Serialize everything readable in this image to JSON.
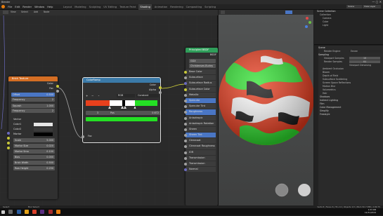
{
  "app": {
    "title": "Blender"
  },
  "menus": [
    "File",
    "Edit",
    "Render",
    "Window",
    "Help"
  ],
  "workspaces": [
    "Layout",
    "Modeling",
    "Sculpting",
    "UV Editing",
    "Texture Paint",
    "Shading",
    "Animation",
    "Rendering",
    "Compositing",
    "Scripting"
  ],
  "active_workspace": "Shading",
  "brick_node": {
    "title": "Brick Texture",
    "outputs": [
      "Color",
      "Fac"
    ],
    "offset_label": "Offset",
    "offset_value": "0.500",
    "frequency_label": "Frequency",
    "frequency_value": "2",
    "squash_label": "Squash",
    "squash_value": "1.000",
    "squash_freq_label": "Frequency",
    "squash_freq_value": "2",
    "inputs": [
      "Vector",
      "Color1",
      "Color2",
      "Mortar"
    ],
    "scale_label": "Scale",
    "scale_value": "5.000",
    "mortar_size_label": "Mortar Size",
    "mortar_size_value": "0.020",
    "mortar_smooth_label": "Mortar Smo",
    "mortar_smooth_value": "0.100",
    "bias_label": "Bias",
    "bias_value": "0.000",
    "brick_width_label": "Brick Width",
    "brick_width_value": "0.500",
    "row_height_label": "Row Height",
    "row_height_value": "0.250"
  },
  "colorramp_node": {
    "title": "ColorRamp",
    "outputs": [
      "Color",
      "Alpha"
    ],
    "mode": "RGB",
    "interpolation": "Constant",
    "stop_index": "3",
    "pos_label": "Pos",
    "pos_value": "0.672",
    "input": "Fac",
    "colors": {
      "red": "#e8401c",
      "white": "#ffffff",
      "black": "#000000",
      "green": "#24e024"
    }
  },
  "bsdf_node": {
    "title": "Principled BSDF",
    "output": "BSDF",
    "distribution": "GGX",
    "subsurface_method": "Christensen-Burley",
    "inputs": [
      "Base Color",
      "Subsurface",
      "Subsurface Radius",
      "Subsurface Color",
      "Metallic",
      "Specular",
      "Specular Tint",
      "Roughness",
      "Anisotropic",
      "Anisotropic Rotation",
      "Sheen",
      "Sheen Tint",
      "Clearcoat",
      "Clearcoat Roughness",
      "IOR",
      "Transmission",
      "Transmission Roughness",
      "Normal"
    ]
  },
  "outliner": {
    "title": "Scene Collection",
    "items": [
      "Collection",
      "Camera",
      "Cube",
      "Light"
    ]
  },
  "properties": {
    "section": "Scene",
    "render_engine_label": "Render Engine",
    "render_engine": "Eevee",
    "sampling": "Sampling",
    "viewport_samples_label": "Viewport Samples",
    "viewport_samples": "16",
    "render_samples_label": "Render Samples",
    "render_samples": "64",
    "denoise": "Viewport Denoising",
    "panels": [
      "Ambient Occlusion",
      "Bloom",
      "Depth of Field",
      "Subsurface Scattering",
      "Screen Space Reflections",
      "Motion Blur",
      "Volumetrics",
      "Hair",
      "Shadows",
      "Indirect Lighting",
      "Film",
      "Color Management",
      "Simplify",
      "Freestyle"
    ]
  },
  "statusbar": {
    "left": "Select",
    "middle": "Box Select",
    "right": "Verts 8 | Faces 6 | Tris 12 | Objects 1/3 | Mem 50.7 MiB | 2.80.75"
  },
  "clock": {
    "time": "4:33 PM",
    "date": "12/31/2019"
  }
}
